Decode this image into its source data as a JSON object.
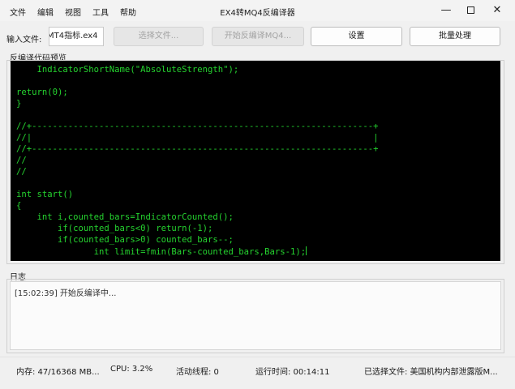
{
  "window": {
    "title": "EX4转MQ4反编译器",
    "menu": [
      "文件",
      "编辑",
      "视图",
      "工具",
      "帮助"
    ],
    "controls": {
      "minimize": "—",
      "close": "✕"
    }
  },
  "toolbar": {
    "input_label": "输入文件:",
    "input_value": "MT4指标.ex4",
    "select_file": "选择文件...",
    "start_decompile": "开始反编译MQ4...",
    "settings": "设置",
    "batch": "批量处理"
  },
  "code_preview": {
    "label": "反编译代码预览",
    "lines": [
      "    IndicatorShortName(\"AbsoluteStrength\");",
      "",
      "return(0);",
      "}",
      "",
      "//+------------------------------------------------------------------+",
      "//|                                                                  |",
      "//+------------------------------------------------------------------+",
      "//",
      "//",
      "",
      "int start()",
      "{",
      "    int i,counted_bars=IndicatorCounted();",
      "        if(counted_bars<0) return(-1);",
      "        if(counted_bars>0) counted_bars--;",
      "               int limit=fmin(Bars-counted_bars,Bars-1);"
    ]
  },
  "log": {
    "label": "日志",
    "entries": [
      "[15:02:39] 开始反编译中..."
    ]
  },
  "status": {
    "memory": "内存: 47/16368 MB...",
    "cpu": "CPU: 3.2%",
    "threads": "活动线程: 0",
    "runtime": "运行时间: 00:14:11",
    "selected_file": "已选择文件: 美国机构内部泄露版M..."
  },
  "colors": {
    "code_bg": "#000000",
    "code_text": "#25d32f",
    "window_bg": "#f0f0f0"
  }
}
